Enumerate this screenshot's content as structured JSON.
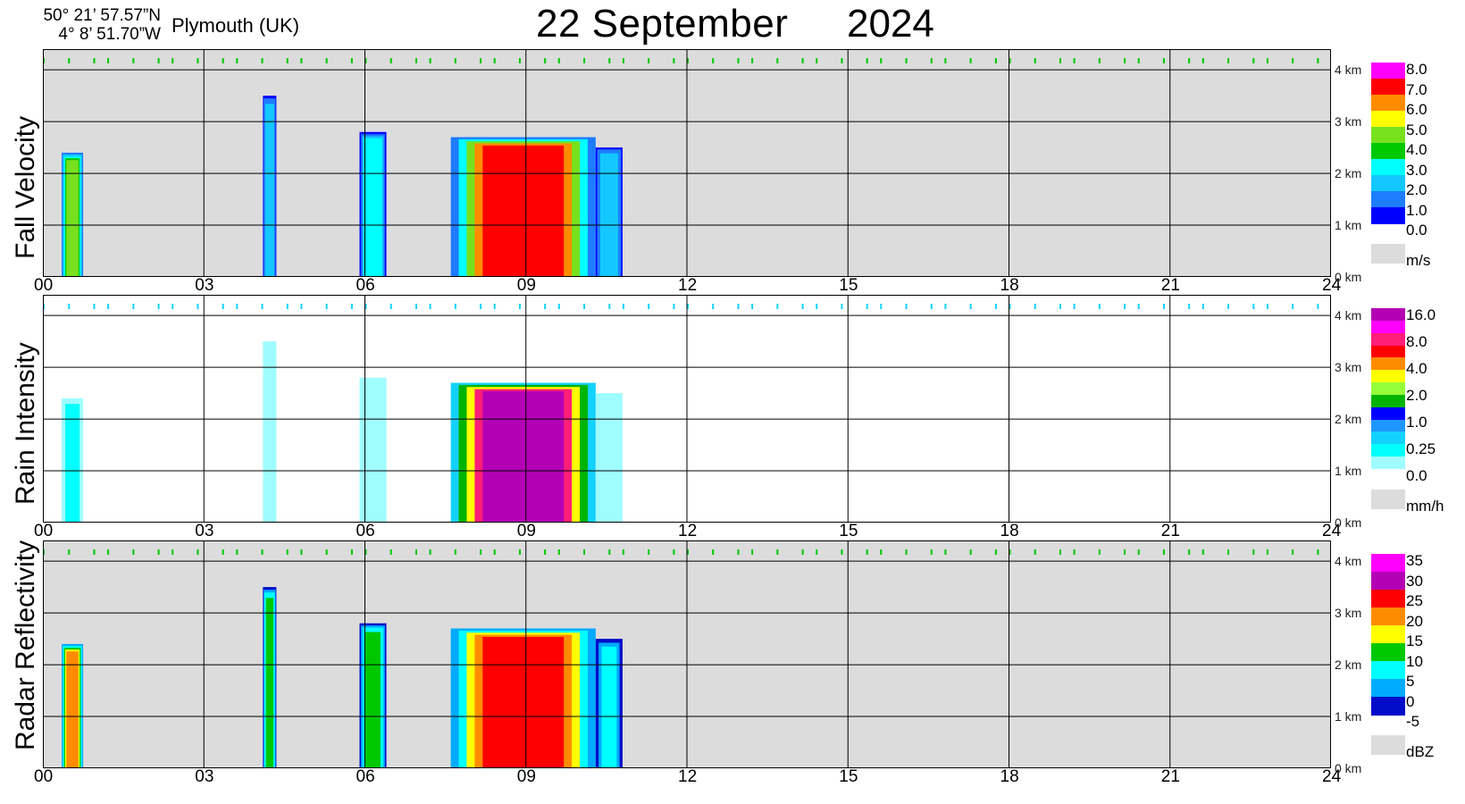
{
  "header": {
    "latitude": "50° 21’ 57.57”N",
    "longitude": "4°  8’ 51.70”W",
    "location": "Plymouth (UK)",
    "title": "22 September",
    "year": "2024"
  },
  "x_ticks": [
    "00",
    "03",
    "06",
    "09",
    "12",
    "15",
    "18",
    "21",
    "24"
  ],
  "altitude_ticks": [
    "4 km",
    "3 km",
    "2 km",
    "1 km",
    "0 km"
  ],
  "colors": {
    "no_data_bg": "#dcdcdc",
    "fall_velocity_scale": [
      "#0000ff",
      "#1e7cff",
      "#14c8ff",
      "#00ffff",
      "#00c800",
      "#78e11e",
      "#ffff00",
      "#ff8c00",
      "#ff0000",
      "#ff00ff"
    ],
    "rain_scale": [
      "#9ffcff",
      "#00ffff",
      "#14d2ff",
      "#1e96ff",
      "#0000ff",
      "#00b400",
      "#96ff3c",
      "#ffff00",
      "#ff8c00",
      "#ff0000",
      "#ff1e78",
      "#ff00ff",
      "#b400b4"
    ],
    "dbz_scale": [
      "#000cc8",
      "#00aaff",
      "#00ffff",
      "#00c800",
      "#ffff00",
      "#ff8c00",
      "#ff0000",
      "#b400b4",
      "#ff00ff"
    ]
  },
  "chart_data": [
    {
      "type": "heatmap",
      "title": "Fall Velocity",
      "ylabel": "Fall Velocity",
      "unit": "m/s",
      "x_range_hours": [
        0,
        24
      ],
      "y_range_km": [
        0,
        4.4
      ],
      "colorbar_labels": [
        "8.0",
        "7.0",
        "6.0",
        "5.0",
        "4.0",
        "3.0",
        "2.0",
        "1.0",
        "0.0"
      ],
      "precipitation_events": [
        {
          "start_h": 0.35,
          "end_h": 0.75,
          "top_km": 2.4,
          "peak_value": 4.0
        },
        {
          "start_h": 4.1,
          "end_h": 4.35,
          "top_km": 3.5,
          "peak_value": 2.0
        },
        {
          "start_h": 5.9,
          "end_h": 6.4,
          "top_km": 2.8,
          "peak_value": 3.0
        },
        {
          "start_h": 7.6,
          "end_h": 10.3,
          "top_km": 2.7,
          "peak_value": 7.0
        },
        {
          "start_h": 10.3,
          "end_h": 10.8,
          "top_km": 2.5,
          "peak_value": 2.0
        }
      ]
    },
    {
      "type": "heatmap",
      "title": "Rain Intensity",
      "ylabel": "Rain Intensity",
      "unit": "mm/h",
      "x_range_hours": [
        0,
        24
      ],
      "y_range_km": [
        0,
        4.4
      ],
      "colorbar_labels": [
        "16.0",
        "8.0",
        "4.0",
        "2.0",
        "1.0",
        "0.25",
        "0.0"
      ],
      "precipitation_events": [
        {
          "start_h": 0.35,
          "end_h": 0.75,
          "top_km": 2.4,
          "peak_value": 2.0
        },
        {
          "start_h": 4.1,
          "end_h": 4.35,
          "top_km": 3.5,
          "peak_value": 1.0
        },
        {
          "start_h": 5.9,
          "end_h": 6.4,
          "top_km": 2.8,
          "peak_value": 0.25
        },
        {
          "start_h": 7.6,
          "end_h": 10.3,
          "top_km": 2.7,
          "peak_value": 16.0
        },
        {
          "start_h": 10.3,
          "end_h": 10.8,
          "top_km": 2.5,
          "peak_value": 0.25
        }
      ]
    },
    {
      "type": "heatmap",
      "title": "Radar Reflectivity",
      "ylabel": "Radar Reflectivity",
      "unit": "dBZ",
      "x_range_hours": [
        0,
        24
      ],
      "y_range_km": [
        0,
        4.4
      ],
      "colorbar_labels": [
        "35",
        "30",
        "25",
        "20",
        "15",
        "10",
        "5",
        "0",
        "-5"
      ],
      "precipitation_events": [
        {
          "start_h": 0.35,
          "end_h": 0.75,
          "top_km": 2.4,
          "peak_value": 20
        },
        {
          "start_h": 4.1,
          "end_h": 4.35,
          "top_km": 3.5,
          "peak_value": 10
        },
        {
          "start_h": 5.9,
          "end_h": 6.4,
          "top_km": 2.8,
          "peak_value": 10
        },
        {
          "start_h": 7.6,
          "end_h": 10.3,
          "top_km": 2.7,
          "peak_value": 25
        },
        {
          "start_h": 10.3,
          "end_h": 10.8,
          "top_km": 2.5,
          "peak_value": 5
        }
      ]
    }
  ]
}
